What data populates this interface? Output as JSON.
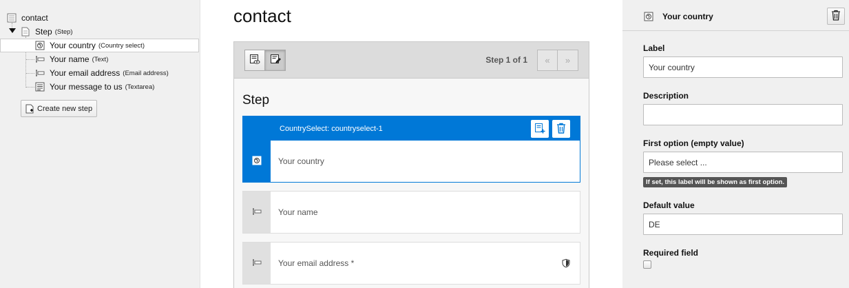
{
  "tree": {
    "root": "contact",
    "step": {
      "label": "Step",
      "type": "(Step)"
    },
    "items": [
      {
        "label": "Your country",
        "type": "(Country select)",
        "icon": "country-select-icon"
      },
      {
        "label": "Your name",
        "type": "(Text)",
        "icon": "text-field-icon"
      },
      {
        "label": "Your email address",
        "type": "(Email address)",
        "icon": "email-field-icon"
      },
      {
        "label": "Your message to us",
        "type": "(Textarea)",
        "icon": "textarea-icon"
      }
    ],
    "create_step_label": "Create new step"
  },
  "stage": {
    "title": "contact",
    "step_indicator": "Step 1 of 1",
    "prev_label": "«",
    "next_label": "»",
    "step_heading": "Step",
    "active_element": {
      "identifier": "CountrySelect: countryselect-1",
      "label": "Your country"
    },
    "elements": [
      {
        "label": "Your name"
      },
      {
        "label": "Your email address *"
      }
    ]
  },
  "inspector": {
    "title": "Your country",
    "label_caption": "Label",
    "label_value": "Your country",
    "description_caption": "Description",
    "description_value": "",
    "first_option_caption": "First option (empty value)",
    "first_option_value": "Please select ...",
    "first_option_hint": "If set, this label will be shown as first option.",
    "default_caption": "Default value",
    "default_value": "DE",
    "required_caption": "Required field"
  },
  "colors": {
    "accent": "#0078d7",
    "panel_bg": "#f0f0f0"
  }
}
